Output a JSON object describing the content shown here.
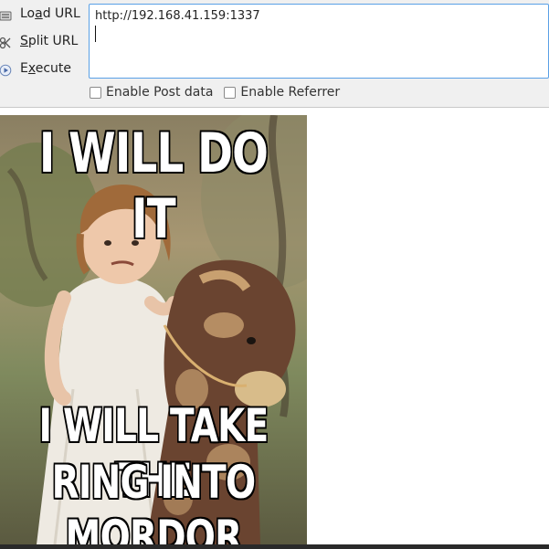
{
  "toolbar": {
    "load_url": {
      "pre": "Lo",
      "key": "a",
      "post": "d URL"
    },
    "split_url": {
      "pre": "",
      "key": "S",
      "post": "plit URL"
    },
    "execute": {
      "pre": "E",
      "key": "x",
      "post": "ecute"
    },
    "url_value": "http://192.168.41.159:1337",
    "enable_post_data": "Enable Post data",
    "enable_referrer": "Enable Referrer",
    "post_checked": false,
    "referrer_checked": false
  },
  "meme": {
    "top_text": "I WILL DO IT",
    "bottom_line_1": "I WILL TAKE THE",
    "bottom_line_2": "RING INTO",
    "bottom_line_3": "MORDOR"
  },
  "colors": {
    "accent_border": "#5aa0e6",
    "toolbar_bg": "#f0f0f0"
  }
}
